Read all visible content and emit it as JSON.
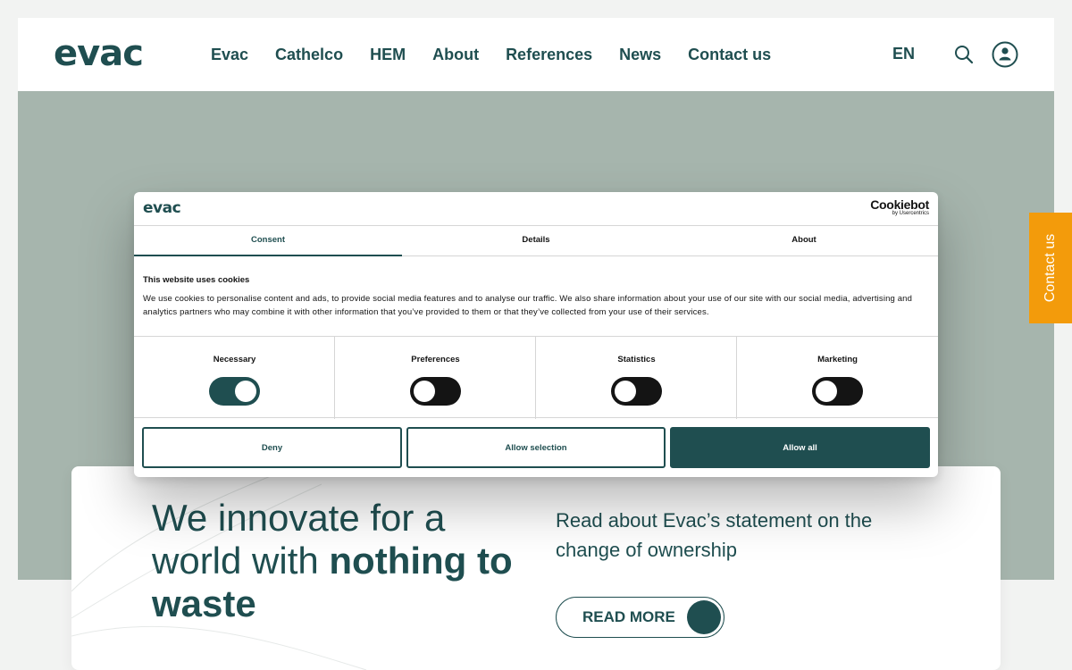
{
  "header": {
    "logo": "evac",
    "nav": [
      "Evac",
      "Cathelco",
      "HEM",
      "About",
      "References",
      "News",
      "Contact us"
    ],
    "language": "EN"
  },
  "side_tab": {
    "label": "Contact us"
  },
  "hero_card": {
    "headline_regular": "We innovate for a world with ",
    "headline_bold": "nothing to waste",
    "statement": "Read about Evac’s statement on the change of ownership",
    "button_label": "READ MORE"
  },
  "cookie_dialog": {
    "logo": "evac",
    "provider": "Cookiebot",
    "provider_sub": "by Usercentrics",
    "tabs": [
      "Consent",
      "Details",
      "About"
    ],
    "active_tab": "Consent",
    "title": "This website uses cookies",
    "text": "We use cookies to personalise content and ads, to provide social media features and to analyse our traffic. We also share information about your use of our site with our social media, advertising and analytics partners who may combine it with other information that you’ve provided to them or that they’ve collected from your use of their services.",
    "toggles": [
      {
        "label": "Necessary",
        "state": "on"
      },
      {
        "label": "Preferences",
        "state": "off"
      },
      {
        "label": "Statistics",
        "state": "off"
      },
      {
        "label": "Marketing",
        "state": "off"
      }
    ],
    "buttons": {
      "deny": "Deny",
      "allow_selection": "Allow selection",
      "allow_all": "Allow all"
    }
  },
  "colors": {
    "brand": "#1f4e50",
    "hero_bg": "#a6b5ad",
    "accent": "#f39b0b"
  }
}
